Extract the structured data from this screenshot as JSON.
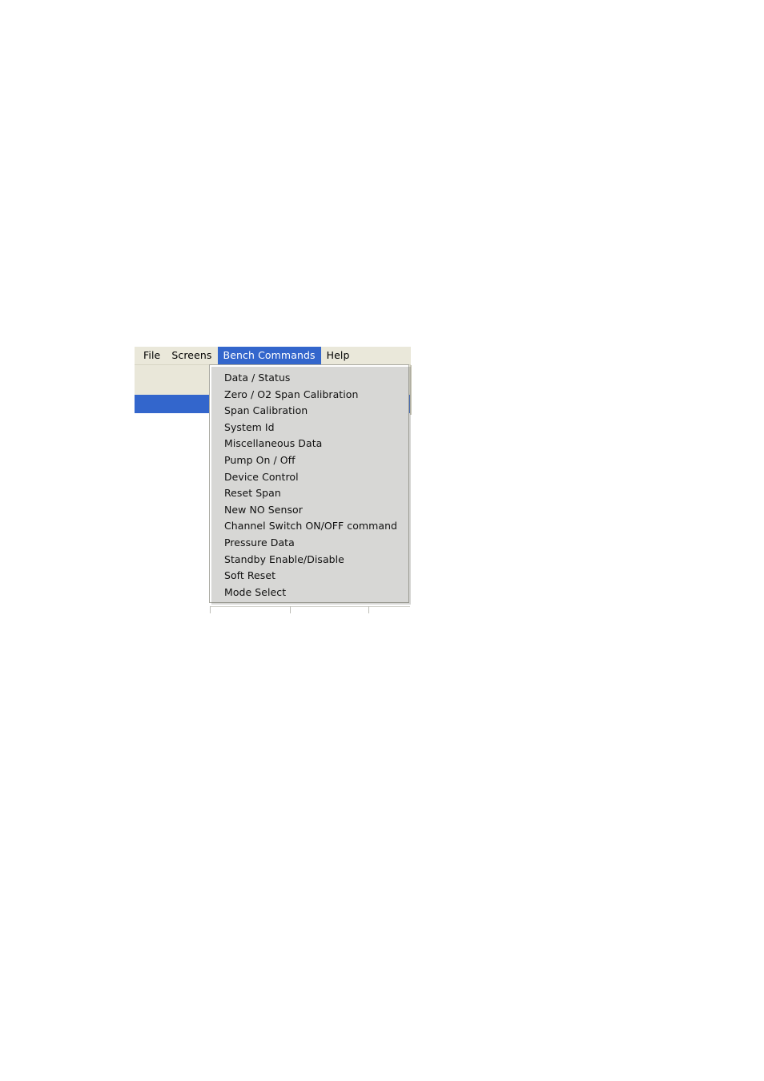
{
  "window": {
    "title": "Bench Commands",
    "menubar": {
      "items": [
        {
          "label": "File",
          "active": false
        },
        {
          "label": "Screens",
          "active": false
        },
        {
          "label": "Bench Commands",
          "active": true
        },
        {
          "label": "Help",
          "active": false
        }
      ]
    },
    "client": {
      "toolbar_strip_color": "#e9e7d9",
      "selected_row_color": "#3366cc"
    }
  },
  "dropdown": {
    "owner": "Bench Commands",
    "items": [
      {
        "label": "Data / Status"
      },
      {
        "label": "Zero / O2 Span Calibration"
      },
      {
        "label": "Span Calibration"
      },
      {
        "label": "System Id"
      },
      {
        "label": "Miscellaneous Data"
      },
      {
        "label": "Pump On / Off"
      },
      {
        "label": "Device Control"
      },
      {
        "label": "Reset Span"
      },
      {
        "label": "New NO Sensor"
      },
      {
        "label": "Channel Switch ON/OFF command"
      },
      {
        "label": "Pressure Data"
      },
      {
        "label": "Standby Enable/Disable"
      },
      {
        "label": "Soft Reset"
      },
      {
        "label": "Mode Select"
      }
    ]
  },
  "grid": {
    "column_tick_positions": [
      262,
      362,
      460
    ]
  },
  "colors": {
    "menu_bar_background": "#eae8da",
    "highlight_blue": "#3366cc",
    "menu_text": "#000000",
    "highlight_text": "#ffffff",
    "dropdown_background": "#ffffff",
    "dropdown_border": "#a8a8a0",
    "page_background": "#ffffff"
  }
}
